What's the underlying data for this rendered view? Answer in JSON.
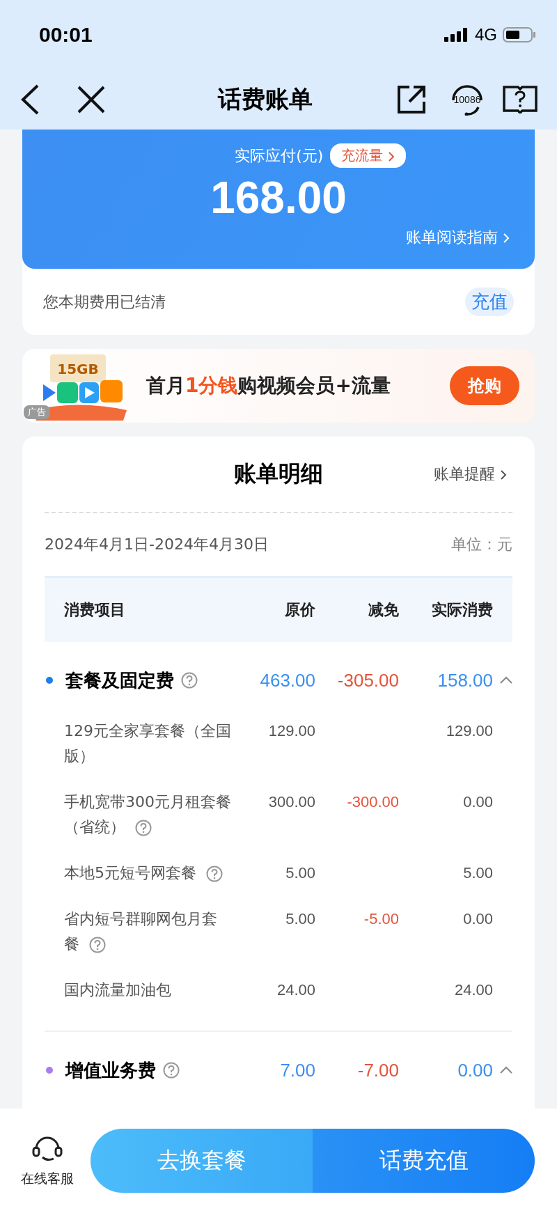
{
  "status_bar": {
    "time": "00:01",
    "network": "4G"
  },
  "nav": {
    "title": "话费账单",
    "service_number": "10086"
  },
  "summary": {
    "label": "实际应付(元)",
    "traffic_button": "充流量",
    "amount": "168.00",
    "guide_link": "账单阅读指南",
    "settled_text": "您本期费用已结清",
    "recharge_button": "充值"
  },
  "ad": {
    "volume": "15GB",
    "tag": "广告",
    "title_parts": [
      {
        "text": "首月",
        "highlight": false
      },
      {
        "text": "1分钱",
        "highlight": true
      },
      {
        "text": "购视频会员+流量",
        "highlight": false
      }
    ],
    "button": "抢购"
  },
  "detail": {
    "title": "账单明细",
    "reminder_link": "账单提醒",
    "period": "2024年4月1日-2024年4月30日",
    "unit": "单位：元",
    "columns": [
      "消费项目",
      "原价",
      "减免",
      "实际消费"
    ],
    "groups": [
      {
        "name": "套餐及固定费",
        "color": "#1a7ff0",
        "help": true,
        "expanded": true,
        "original": "463.00",
        "discount": "-305.00",
        "actual": "158.00",
        "items": [
          {
            "name": "129元全家享套餐（全国版）",
            "help": false,
            "original": "129.00",
            "actual": "129.00"
          },
          {
            "name": "手机宽带300元月租套餐（省统）",
            "help": true,
            "original": "300.00",
            "discount": "-300.00",
            "actual": "0.00"
          },
          {
            "name": "本地5元短号网套餐",
            "help": true,
            "original": "5.00",
            "actual": "5.00"
          },
          {
            "name": "省内短号群聊网包月套餐",
            "help": true,
            "original": "5.00",
            "discount": "-5.00",
            "actual": "0.00"
          },
          {
            "name": "国内流量加油包",
            "help": false,
            "original": "24.00",
            "actual": "24.00"
          }
        ]
      },
      {
        "name": "增值业务费",
        "color": "#a97cf0",
        "help": true,
        "expanded": true,
        "original": "7.00",
        "discount": "-7.00",
        "actual": "0.00"
      }
    ]
  },
  "bottom": {
    "service_label": "在线客服",
    "change_button": "去换套餐",
    "recharge_button": "话费充值"
  }
}
